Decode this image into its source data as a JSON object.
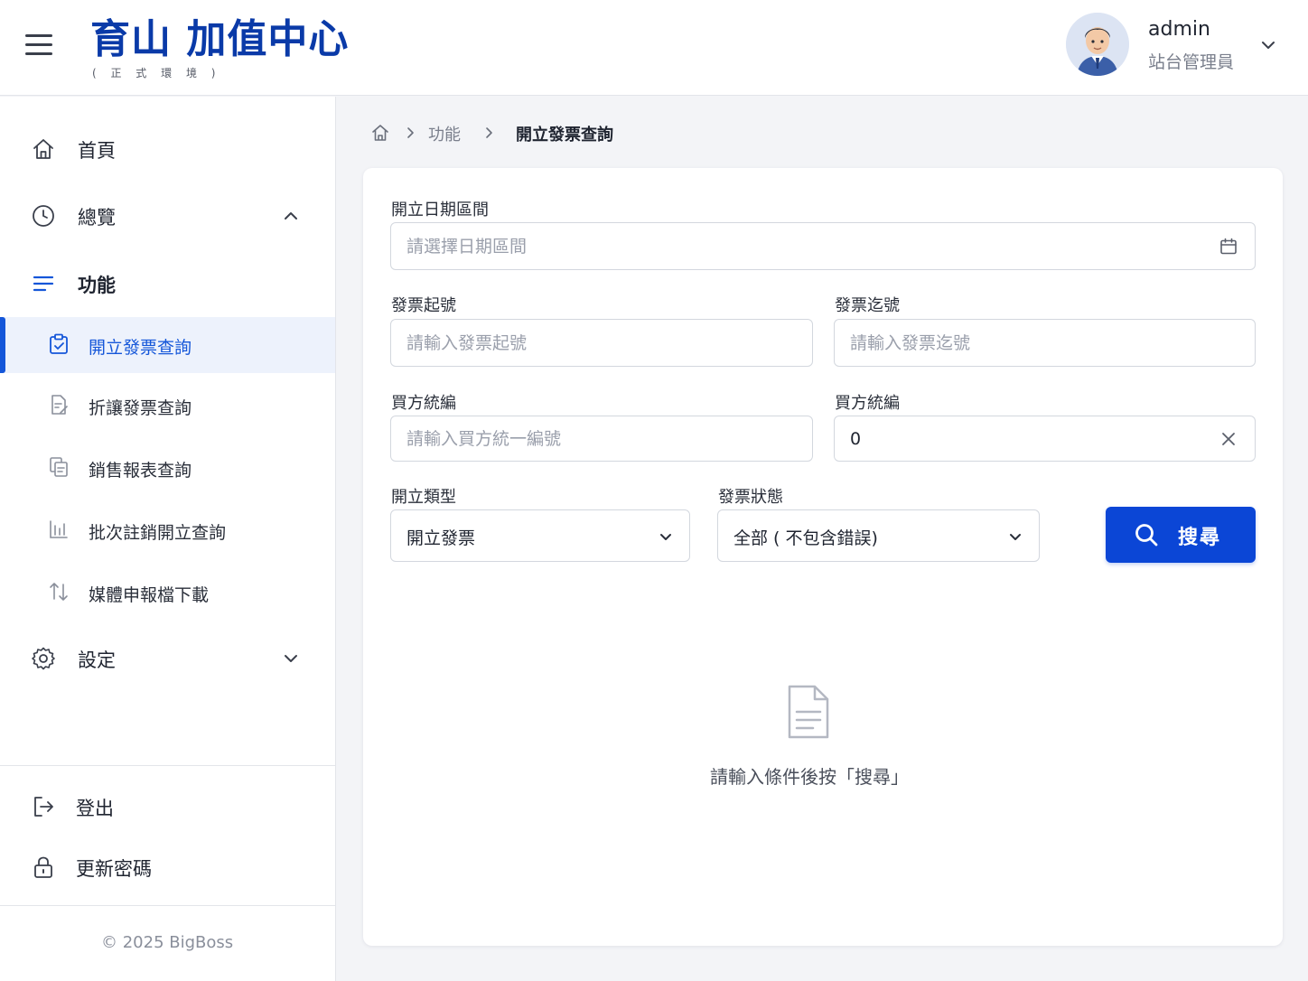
{
  "header": {
    "brand_title": "育山 加值中心",
    "brand_subtitle": "( 正 式 環 境 )",
    "user_name": "admin",
    "user_role": "站台管理員"
  },
  "sidebar": {
    "items": [
      {
        "label": "首頁",
        "icon": "home-icon"
      },
      {
        "label": "總覽",
        "icon": "clock-icon"
      },
      {
        "label": "功能",
        "icon": "list-icon"
      },
      {
        "label": "設定",
        "icon": "gear-icon"
      }
    ],
    "sub_items": [
      {
        "label": "開立發票查詢",
        "icon": "clipboard-icon",
        "active": true
      },
      {
        "label": "折讓發票查詢",
        "icon": "document-edit-icon"
      },
      {
        "label": "銷售報表查詢",
        "icon": "copy-document-icon"
      },
      {
        "label": "批次註銷開立查詢",
        "icon": "bar-chart-icon"
      },
      {
        "label": "媒體申報檔下載",
        "icon": "arrows-up-down-icon"
      }
    ],
    "logout_label": "登出",
    "change_password_label": "更新密碼",
    "copyright": "© 2025 BigBoss"
  },
  "breadcrumb": {
    "parent": "功能",
    "current": "開立發票查詢"
  },
  "form": {
    "date_range_label": "開立日期區間",
    "date_range_placeholder": "請選擇日期區間",
    "invoice_start_label": "發票起號",
    "invoice_start_placeholder": "請輸入發票起號",
    "invoice_end_label": "發票迄號",
    "invoice_end_placeholder": "請輸入發票迄號",
    "buyer_id_label": "買方統編",
    "buyer_id_placeholder": "請輸入買方統一編號",
    "buyer_id2_label": "買方統編",
    "buyer_id2_value": "0",
    "issue_type_label": "開立類型",
    "issue_type_value": "開立發票",
    "invoice_status_label": "發票狀態",
    "invoice_status_value": "全部 ( 不包含錯誤)",
    "search_button": "搜尋"
  },
  "empty_state": {
    "text": "請輸入條件後按「搜尋」"
  },
  "colors": {
    "brand": "#0a3aa8",
    "accent": "#1456d9",
    "button": "#0b46d6",
    "active_bg": "#edf2fc"
  }
}
